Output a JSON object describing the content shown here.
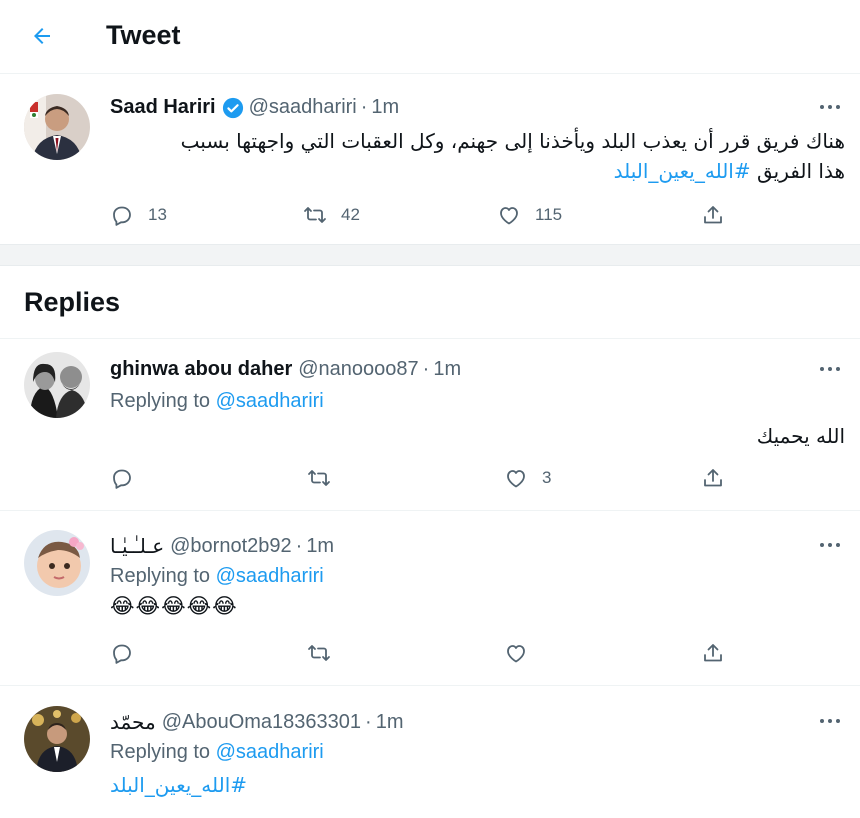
{
  "header": {
    "title": "Tweet"
  },
  "tweet": {
    "display_name": "Saad Hariri",
    "handle": "@saadhariri",
    "separator": "·",
    "time": "1m",
    "text_line1": "هناك فريق قرر أن يعذب البلد ويأخذنا إلى جهنم، وكل العقبات التي واجهتها بسبب",
    "text_line2_prefix": "هذا الفريق",
    "hashtag": "#الله_يعين_البلد",
    "stats": {
      "replies": "13",
      "retweets": "42",
      "likes": "115"
    }
  },
  "replies_heading": "Replies",
  "replies": [
    {
      "display_name": "ghinwa abou daher",
      "handle": "@nanoooo87",
      "separator": "·",
      "time": "1m",
      "replying_prefix": "Replying to",
      "replying_to": "@saadhariri",
      "text": "الله يحميك",
      "likes": "3"
    },
    {
      "display_name": "عـلـٰـيٰـا",
      "handle": "@bornot2b92",
      "separator": "·",
      "time": "1m",
      "replying_prefix": "Replying to",
      "replying_to": "@saadhariri",
      "text": "😂😂😂😂😂"
    },
    {
      "display_name": "محمّد",
      "handle": "@AbouOma18363301",
      "separator": "·",
      "time": "1m",
      "replying_prefix": "Replying to",
      "replying_to": "@saadhariri",
      "text": "#الله_يعين_البلد"
    }
  ],
  "icons": {
    "back": "arrow-left-icon",
    "more": "more-horizontal-icon",
    "reply": "reply-icon",
    "retweet": "retweet-icon",
    "like": "heart-icon",
    "share": "share-icon",
    "verified": "verified-badge-icon"
  },
  "colors": {
    "accent": "#1d9bf0",
    "text": "#0f1419",
    "secondary": "#536471"
  }
}
